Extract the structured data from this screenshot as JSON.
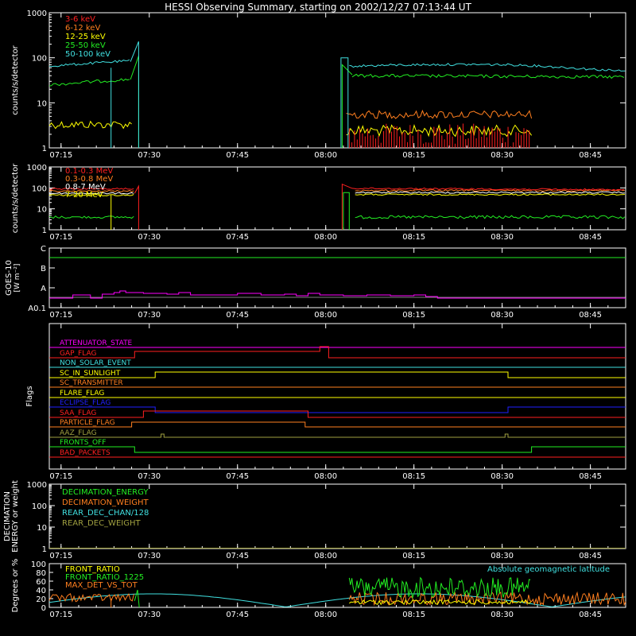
{
  "title": "HESSI Observing Summary, starting on 2002/12/27 07:13:44 UT",
  "time_ticks": [
    "07:15",
    "07:30",
    "07:45",
    "08:00",
    "08:15",
    "08:30",
    "08:45"
  ],
  "colors": {
    "red": "#ff2020",
    "orange": "#ff7f1f",
    "yellow": "#ffff00",
    "green": "#22ee22",
    "cyan": "#40e0e0",
    "magenta": "#ff00ff",
    "blue": "#2020ff",
    "olive": "#a0a040",
    "white": "#ffffff"
  },
  "chart_data": [
    {
      "id": "lo-energy",
      "type": "line",
      "log": true,
      "ylabel": "counts/s/detector",
      "yticks": [
        "1",
        "10",
        "100",
        "1000"
      ],
      "ylim": [
        1,
        1000
      ],
      "series": [
        {
          "name": "3-6 keV",
          "color": "red"
        },
        {
          "name": "6-12 keV",
          "color": "orange"
        },
        {
          "name": "12-25 keV",
          "color": "yellow"
        },
        {
          "name": "25-50 keV",
          "color": "green"
        },
        {
          "name": "50-100 keV",
          "color": "cyan"
        }
      ]
    },
    {
      "id": "hi-energy",
      "type": "line",
      "log": true,
      "ylabel": "counts/s/detector",
      "yticks": [
        "1",
        "10",
        "100",
        "1000"
      ],
      "ylim": [
        1,
        1000
      ],
      "series": [
        {
          "name": "0.1-0.3 MeV",
          "color": "red"
        },
        {
          "name": "0.3-0.8 MeV",
          "color": "orange"
        },
        {
          "name": "0.8-7 MeV",
          "color": "white"
        },
        {
          "name": "7-20 MeV",
          "color": "yellow"
        }
      ]
    },
    {
      "id": "goes",
      "type": "line",
      "ylabel": "GOES-10",
      "yunit": "[W m⁻²]",
      "yticks": [
        "A0.1",
        "A",
        "B",
        "C"
      ]
    },
    {
      "id": "flags",
      "type": "line",
      "ylabel": "Flags",
      "series": [
        {
          "name": "ATTENUATOR_STATE",
          "color": "magenta"
        },
        {
          "name": "GAP_FLAG",
          "color": "red"
        },
        {
          "name": "NON_SOLAR_EVENT",
          "color": "cyan"
        },
        {
          "name": "SC_IN_SUNLIGHT",
          "color": "yellow"
        },
        {
          "name": "SC_TRANSMITTER",
          "color": "orange"
        },
        {
          "name": "FLARE_FLAG",
          "color": "yellow"
        },
        {
          "name": "ECLIPSE_FLAG",
          "color": "blue"
        },
        {
          "name": "SAA_FLAG",
          "color": "red"
        },
        {
          "name": "PARTICLE_FLAG",
          "color": "orange"
        },
        {
          "name": "AAZ_FLAG",
          "color": "olive"
        },
        {
          "name": "FRONTS_OFF",
          "color": "green"
        },
        {
          "name": "BAD_PACKETS",
          "color": "red"
        }
      ]
    },
    {
      "id": "decimation",
      "type": "line",
      "log": true,
      "ylabel": "DECIMATION",
      "ylabel2": "ENERGY or weight",
      "yticks": [
        "1",
        "10",
        "100",
        "1000"
      ],
      "series": [
        {
          "name": "DECIMATION_ENERGY",
          "color": "green"
        },
        {
          "name": "DECIMATION_WEIGHT",
          "color": "orange"
        },
        {
          "name": "REAR_DEC_CHAN/128",
          "color": "cyan"
        },
        {
          "name": "REAR_DEC_WEIGHT",
          "color": "olive"
        }
      ]
    },
    {
      "id": "ratios",
      "type": "line",
      "ylabel": "Degrees or %",
      "yticks": [
        "0",
        "20",
        "40",
        "60",
        "80",
        "100"
      ],
      "ylim": [
        0,
        100
      ],
      "annotation": "Absolute geomagnetic latitude",
      "series": [
        {
          "name": "FRONT_RATIO",
          "color": "yellow"
        },
        {
          "name": "FRONT_RATIO_1225",
          "color": "green"
        },
        {
          "name": "MAX_DET_VS_TOT",
          "color": "orange"
        }
      ]
    }
  ]
}
